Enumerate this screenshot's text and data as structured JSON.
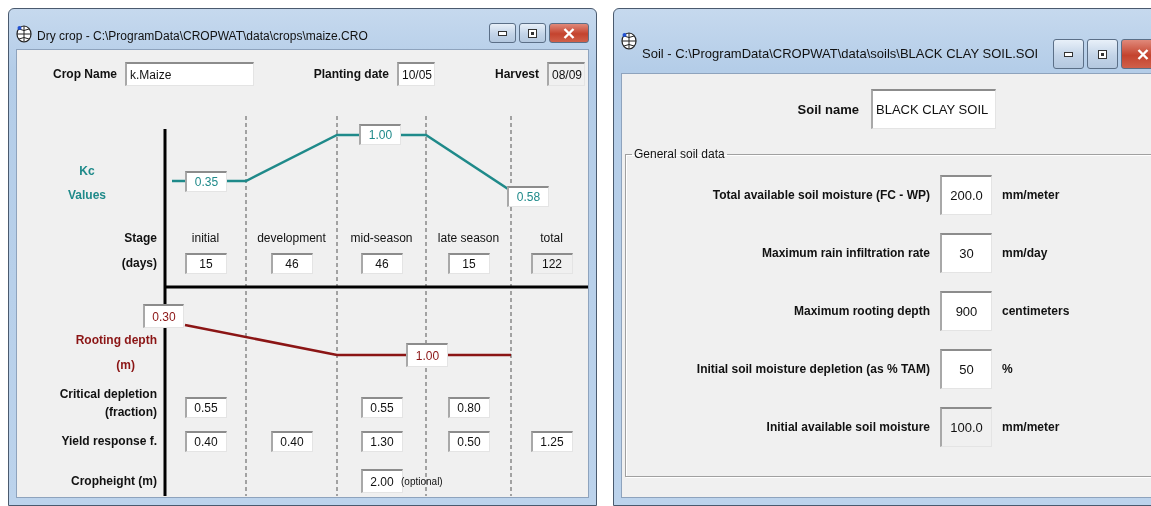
{
  "crop_window": {
    "title": "Dry crop - C:\\ProgramData\\CROPWAT\\data\\crops\\maize.CRO",
    "header": [
      {
        "label": "Crop Name",
        "value": "k.Maize",
        "disabled": false
      },
      {
        "label": "Planting date",
        "value": "10/05",
        "disabled": false
      },
      {
        "label": "Harvest",
        "value": "08/09",
        "disabled": true
      }
    ],
    "kc_values": {
      "label_lines": [
        "Kc",
        "Values"
      ],
      "initial": "0.35",
      "mid_season": "1.00",
      "end": "0.58"
    },
    "stage": {
      "label": "Stage",
      "names": [
        "initial",
        "development",
        "mid-season",
        "late season",
        "total"
      ]
    },
    "days": {
      "label": "(days)",
      "values": [
        {
          "value": "15",
          "disabled": false
        },
        {
          "value": "46",
          "disabled": false
        },
        {
          "value": "46",
          "disabled": false
        },
        {
          "value": "15",
          "disabled": false
        },
        {
          "value": "122",
          "disabled": true
        }
      ]
    },
    "rooting_depth": {
      "label_lines": [
        "Rooting depth",
        "(m)"
      ],
      "initial": "0.30",
      "maximum": "1.00"
    },
    "critical_depletion": {
      "label_lines": [
        "Critical depletion",
        "(fraction)"
      ],
      "initial": "0.55",
      "mid_season": "0.55",
      "late_season": "0.80"
    },
    "yield_response": {
      "label": "Yield response f.",
      "initial": "0.40",
      "development": "0.40",
      "mid_season": "1.30",
      "late_season": "0.50",
      "total": "1.25"
    },
    "cropheight": {
      "label": "Cropheight (m)",
      "mid_season": "2.00",
      "note": "(optional)"
    }
  },
  "soil_window": {
    "title": "Soil - C:\\ProgramData\\CROPWAT\\data\\soils\\BLACK CLAY SOIL.SOI",
    "soil_name": {
      "label": "Soil name",
      "value": "BLACK CLAY SOIL"
    },
    "group": {
      "title": "General soil data",
      "rows": [
        {
          "label": "Total available soil moisture (FC - WP)",
          "value": "200.0",
          "unit": "mm/meter",
          "disabled": false
        },
        {
          "label": "Maximum rain infiltration rate",
          "value": "30",
          "unit": "mm/day",
          "disabled": false
        },
        {
          "label": "Maximum rooting depth",
          "value": "900",
          "unit": "centimeters",
          "disabled": false
        },
        {
          "label": "Initial soil moisture depletion (as % TAM)",
          "value": "50",
          "unit": "%",
          "disabled": false
        },
        {
          "label": "Initial available soil moisture",
          "value": "100.0",
          "unit": "mm/meter",
          "disabled": true
        }
      ]
    }
  }
}
